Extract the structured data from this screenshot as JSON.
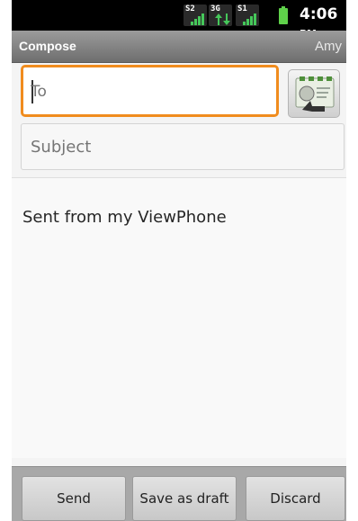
{
  "status_bar": {
    "signal_1": "S2",
    "signal_2": "3G",
    "signal_3": "S1",
    "time": "4:06",
    "ampm": "PM",
    "colors": {
      "signal_green": "#45c85a",
      "battery_green": "#5fd14a"
    }
  },
  "title_bar": {
    "title": "Compose",
    "account": "Amy"
  },
  "compose": {
    "to_placeholder": "To",
    "subject_placeholder": "Subject",
    "body_text": "Sent from my ViewPhone",
    "contacts_icon": "address-book-icon"
  },
  "actions": {
    "send": "Send",
    "save_draft": "Save as draft",
    "discard": "Discard"
  },
  "colors": {
    "focus_border": "#f08c1e"
  }
}
